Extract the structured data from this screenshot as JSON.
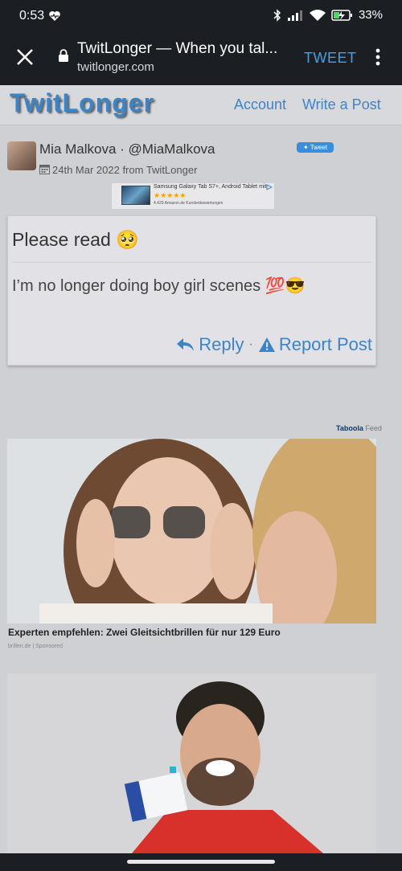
{
  "status_bar": {
    "time": "0:53",
    "battery": "33%"
  },
  "browser": {
    "page_title": "TwitLonger — When you tal...",
    "url": "twitlonger.com",
    "action_label": "TWEET"
  },
  "site": {
    "logo": "TwitLonger",
    "nav": [
      "Account",
      "Write a Post"
    ]
  },
  "post": {
    "author": "Mia Malkova · @MiaMalkova",
    "date": "24th Mar 2022 from TwitLonger",
    "tweet_button": "Tweet",
    "heading": "Please read 🥺",
    "body": "I’m no longer doing boy girl scenes 💯😎",
    "reply_label": "Reply",
    "separator": "·",
    "report_label": "Report Post"
  },
  "banner_ad": {
    "title": "Samsung Galaxy Tab S7+, Android Tablet mit",
    "stars": "★★★★★",
    "reviews": "4.429 Amazon.de Kundenbewertungen"
  },
  "feed": {
    "provider": "Taboola",
    "provider_suffix": "Feed",
    "items": [
      {
        "caption": "Experten empfehlen: Zwei Gleitsichtbrillen für nur 129 Euro",
        "source": "brillen.de | Sponsored"
      }
    ]
  },
  "colors": {
    "accent": "#3d84c6",
    "page_bg": "#cfd0d4",
    "chrome_bg": "#1b1f24"
  }
}
